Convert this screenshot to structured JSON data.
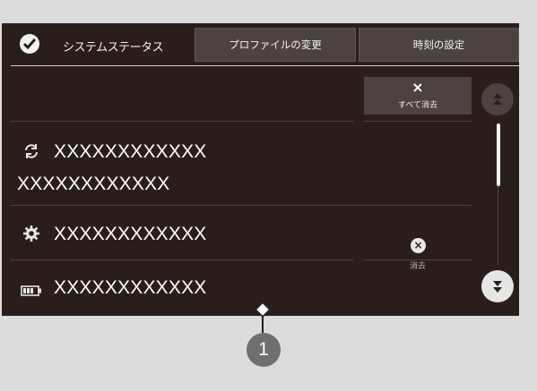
{
  "header": {
    "title": "システムステータス",
    "profile_button": "プロファイルの変更",
    "clock_button": "時刻の設定"
  },
  "clear_all": {
    "icon": "×",
    "label": "すべて消去"
  },
  "notifications": [
    {
      "icon": "sync-icon",
      "line1": "XXXXXXXXXXXX",
      "line2": "XXXXXXXXXXXX"
    },
    {
      "icon": "gear-icon",
      "line1": "XXXXXXXXXXXX",
      "dismiss_icon": "×",
      "dismiss_label": "消去"
    },
    {
      "icon": "battery-icon",
      "line1": "XXXXXXXXXXXX"
    }
  ],
  "callout": {
    "number": "1"
  },
  "colors": {
    "background": "#2a1e1b",
    "button": "#4a4340",
    "text": "#ffffff"
  }
}
